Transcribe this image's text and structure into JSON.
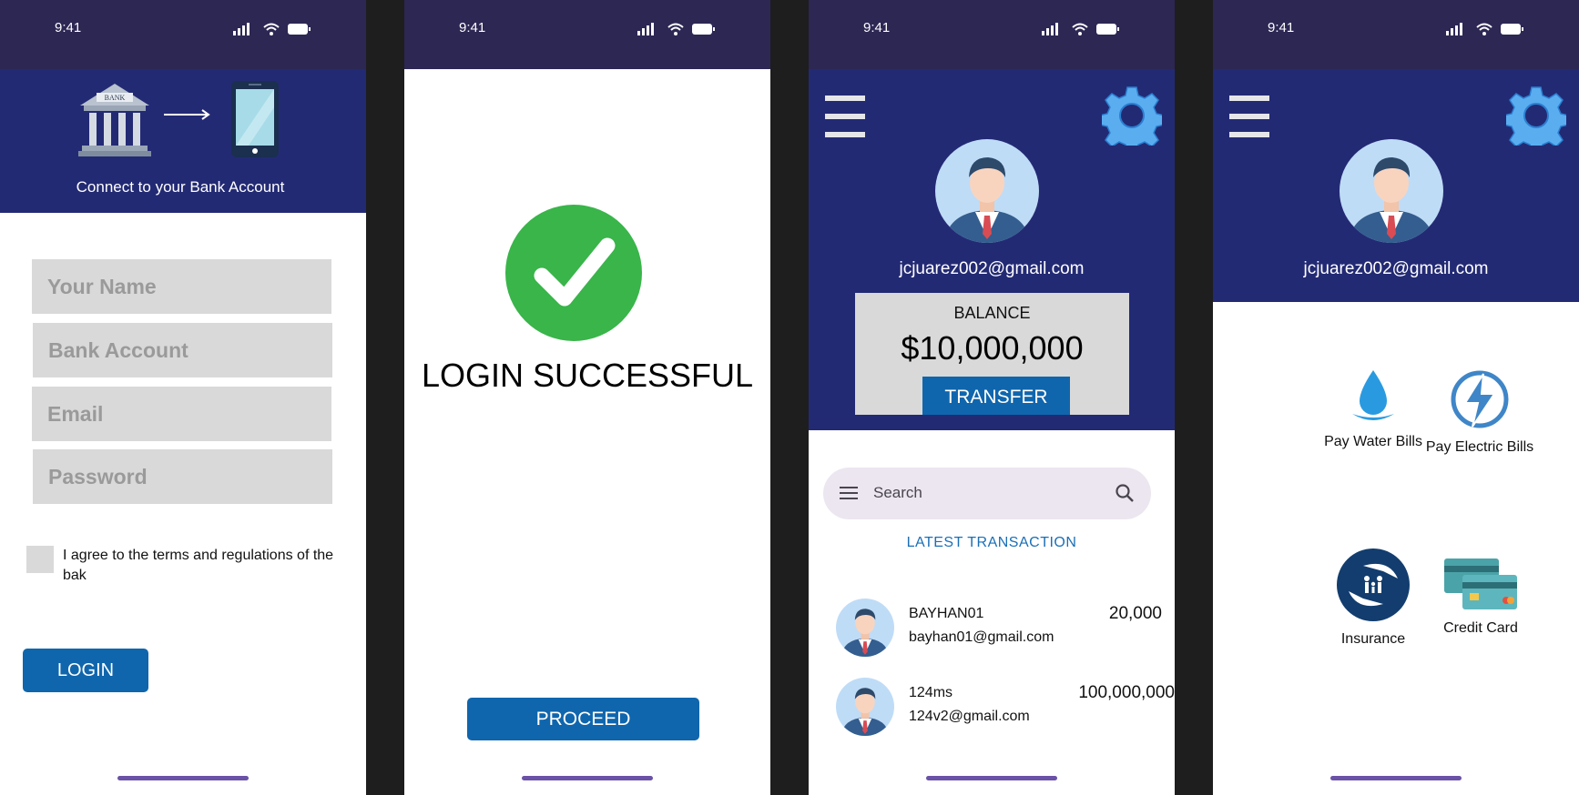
{
  "status": {
    "time": "9:41"
  },
  "screen1": {
    "banner": {
      "bank_sign": "BANK",
      "caption": "Connect to your Bank Account"
    },
    "fields": {
      "name_placeholder": "Your Name",
      "account_placeholder": "Bank Account",
      "email_placeholder": "Email",
      "password_placeholder": "Password"
    },
    "terms_label": "I agree to the terms and regulations of the bak",
    "login_label": "LOGIN"
  },
  "screen2": {
    "message": "LOGIN SUCCESSFUL",
    "proceed_label": "PROCEED"
  },
  "screen3": {
    "email": "jcjuarez002@gmail.com",
    "balance_label": "BALANCE",
    "balance_value": "$10,000,000",
    "transfer_label": "TRANSFER",
    "search_placeholder": "Search",
    "latest_label": "LATEST TRANSACTION",
    "transactions": [
      {
        "name": "BAYHAN01",
        "email": "bayhan01@gmail.com",
        "amount": "20,000"
      },
      {
        "name": "124ms",
        "email": "124v2@gmail.com",
        "amount": "100,000,000"
      }
    ]
  },
  "screen4": {
    "email": "jcjuarez002@gmail.com",
    "services": [
      {
        "label": "Pay Water Bills"
      },
      {
        "label": "Pay Electric Bills"
      },
      {
        "label": "Insurance"
      },
      {
        "label": "Credit Card"
      }
    ]
  },
  "colors": {
    "status_bar": "#2d2754",
    "header": "#232a74",
    "button": "#0f66ad",
    "success": "#39b54a",
    "field": "#d9d9d9",
    "home_indicator": "#6a52a6"
  }
}
